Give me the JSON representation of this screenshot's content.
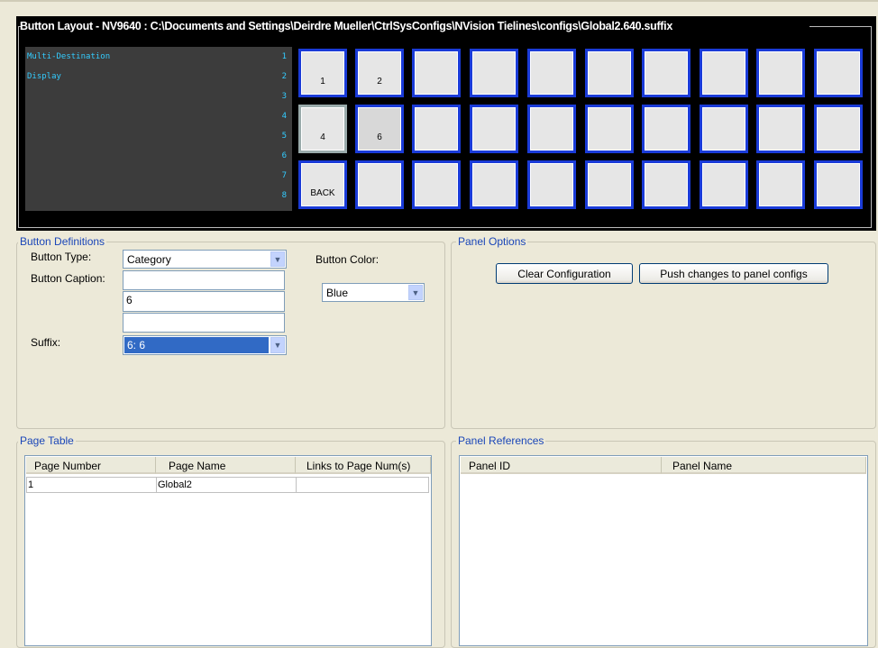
{
  "button_layout": {
    "title": "Button Layout - NV9640 : C:\\Documents and Settings\\Deirdre Mueller\\CtrlSysConfigs\\NVision Tielines\\configs\\Global2.640.suffix",
    "display_lines": [
      "Multi-Destination",
      "Display"
    ],
    "display_numbers": [
      "1",
      "2",
      "3",
      "4",
      "5",
      "6",
      "7",
      "8"
    ],
    "rows": [
      [
        "1",
        "2",
        "",
        "",
        "",
        "",
        "",
        "",
        "",
        ""
      ],
      [
        "4",
        "6",
        "",
        "",
        "",
        "",
        "",
        "",
        "",
        ""
      ],
      [
        "BACK",
        "",
        "",
        "",
        "",
        "",
        "",
        "",
        "",
        ""
      ]
    ]
  },
  "button_definitions": {
    "group_label": "Button Definitions",
    "type_label": "Button Type:",
    "type_value": "Category",
    "caption_label": "Button Caption:",
    "caption_line1": "",
    "caption_line2": "6",
    "caption_line3": "",
    "suffix_label": "Suffix:",
    "suffix_value": "6: 6",
    "color_label": "Button Color:",
    "color_value": "Blue"
  },
  "panel_options": {
    "group_label": "Panel Options",
    "clear_button": "Clear Configuration",
    "push_button": "Push changes to panel configs"
  },
  "page_table": {
    "group_label": "Page Table",
    "columns": [
      "Page Number",
      "Page Name",
      "Links to Page Num(s)"
    ],
    "rows": [
      [
        "1",
        "Global2",
        ""
      ]
    ]
  },
  "panel_references": {
    "group_label": "Panel References",
    "columns": [
      "Panel ID",
      "Panel Name"
    ],
    "rows": []
  },
  "colors": {
    "selected_button_border": "#1a3bd8",
    "group_label": "#1a46b8",
    "display_text": "#33ccff",
    "selection": "#316ac5"
  }
}
